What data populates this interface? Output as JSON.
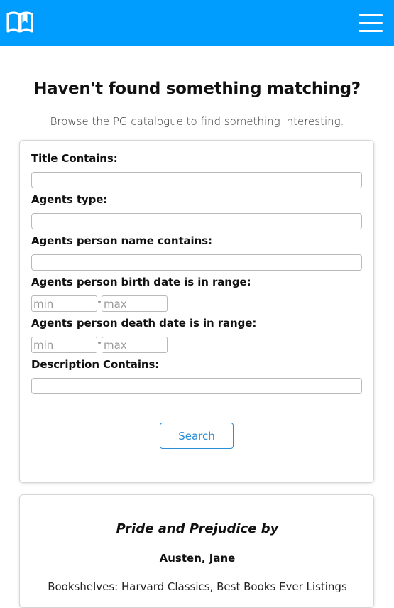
{
  "navbar": {
    "logo_icon": "open-book-icon",
    "menu_icon": "hamburger-menu-icon",
    "background": "#009dff"
  },
  "page": {
    "heading": "Haven't found something matching?",
    "subheading": "Browse the PG catalogue to find something interesting."
  },
  "form": {
    "title_label": "Title Contains:",
    "title_value": "",
    "agents_type_label": "Agents type:",
    "agents_type_value": "",
    "agent_name_label": "Agents person name contains:",
    "agent_name_value": "",
    "birth_label": "Agents person birth date is in range:",
    "birth_min_placeholder": "min",
    "birth_max_placeholder": "max",
    "death_label": "Agents person death date is in range:",
    "death_min_placeholder": "min",
    "death_max_placeholder": "max",
    "range_separator": "-",
    "description_label": "Description Contains:",
    "description_value": "",
    "search_label": "Search",
    "accent_color": "#2b8fd6"
  },
  "result": {
    "title": "Pride and Prejudice by",
    "author": "Austen, Jane",
    "bookshelves": "Bookshelves: Harvard Classics, Best Books Ever Listings"
  }
}
